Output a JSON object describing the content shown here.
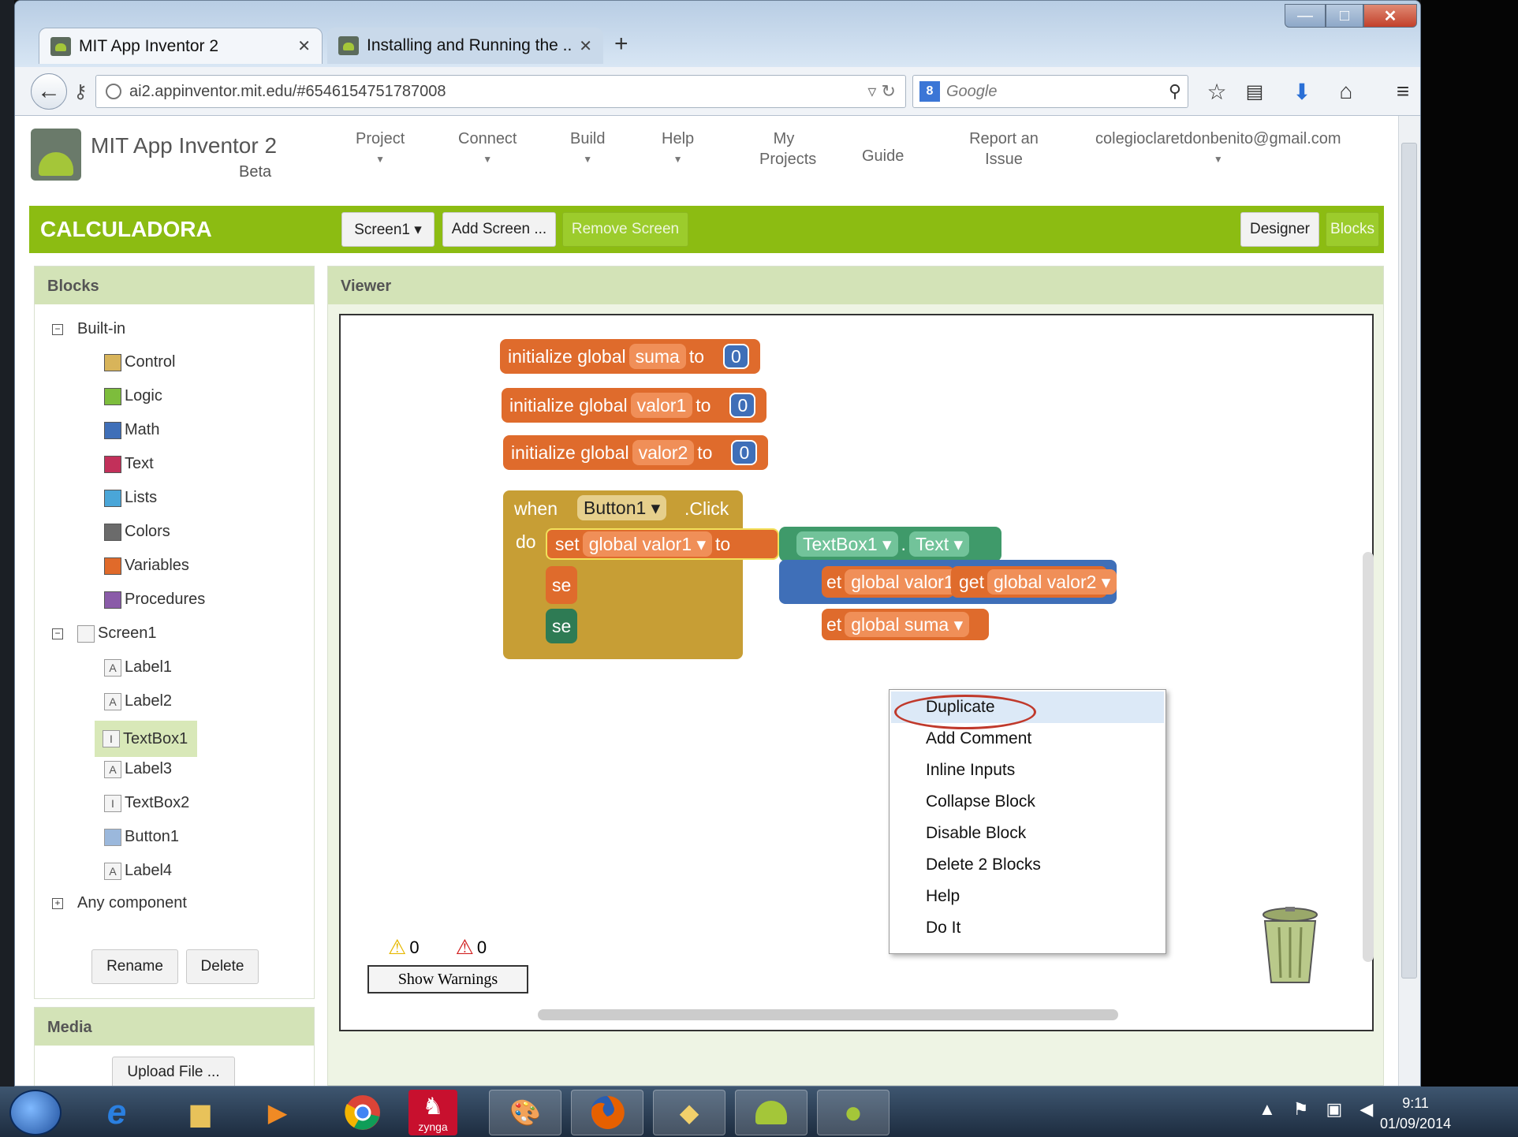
{
  "browser": {
    "tabs": [
      {
        "title": "MIT App Inventor 2",
        "close": "✕"
      },
      {
        "title": "Installing and Running the ...",
        "close": "✕"
      }
    ],
    "new_tab": "+",
    "url": "ai2.appinventor.mit.edu/#6546154751787008",
    "search_placeholder": "Google",
    "search_engine_badge": "8",
    "window_controls": {
      "minimize": "—",
      "maximize": "□",
      "close": "✕"
    }
  },
  "app": {
    "brand": "MIT App Inventor 2",
    "beta": "Beta",
    "menus": [
      "Project",
      "Connect",
      "Build",
      "Help",
      "My Projects",
      "Guide",
      "Report an Issue",
      "colegioclaretdonbenito@gmail.com"
    ],
    "project_name": "CALCULADORA",
    "screen_select": "Screen1 ▾",
    "add_screen": "Add Screen ...",
    "remove_screen": "Remove Screen",
    "designer": "Designer",
    "blocks_btn": "Blocks"
  },
  "blocks_panel": {
    "title": "Blocks",
    "builtin": "Built-in",
    "builtin_items": [
      {
        "label": "Control",
        "color": "#d8b45a"
      },
      {
        "label": "Logic",
        "color": "#7dbd3c"
      },
      {
        "label": "Math",
        "color": "#3f6fb8"
      },
      {
        "label": "Text",
        "color": "#c2305a"
      },
      {
        "label": "Lists",
        "color": "#4aa6d8"
      },
      {
        "label": "Colors",
        "color": "#6b6b6b"
      },
      {
        "label": "Variables",
        "color": "#e06a2a"
      },
      {
        "label": "Procedures",
        "color": "#8a5ba8"
      }
    ],
    "screen": "Screen1",
    "components": [
      "Label1",
      "Label2",
      "TextBox1",
      "Label3",
      "TextBox2",
      "Button1",
      "Label4"
    ],
    "any_component": "Any component",
    "rename": "Rename",
    "delete": "Delete"
  },
  "media_panel": {
    "title": "Media",
    "upload": "Upload File ..."
  },
  "viewer": {
    "title": "Viewer",
    "globals": [
      {
        "prefix": "initialize global",
        "name": "suma",
        "to": "to",
        "value": "0"
      },
      {
        "prefix": "initialize global",
        "name": "valor1",
        "to": "to",
        "value": "0"
      },
      {
        "prefix": "initialize global",
        "name": "valor2",
        "to": "to",
        "value": "0"
      }
    ],
    "event": {
      "when": "when",
      "component": "Button1 ▾",
      "event": ".Click",
      "do": "do",
      "set1": "set",
      "var1": "global valor1 ▾",
      "to": "to",
      "textbox": "TextBox1 ▾",
      "dot": ".",
      "prop": "Text ▾",
      "get_a": "get",
      "var_a": "global valor1 ▾",
      "plus": "+",
      "get_b": "get",
      "var_b": "global valor2 ▾",
      "get_c": "get",
      "var_c": "global suma ▾",
      "frag2": "se",
      "frag3": "se",
      "frag_get_a": "et",
      "frag_get_c": "et"
    },
    "warnings_count": "0",
    "errors_count": "0",
    "show_warnings": "Show Warnings"
  },
  "context_menu": [
    "Duplicate",
    "Add Comment",
    "Inline Inputs",
    "Collapse Block",
    "Disable Block",
    "Delete 2 Blocks",
    "Help",
    "Do It"
  ],
  "taskbar": {
    "time": "9:11",
    "date": "01/09/2014",
    "zynga": "zynga"
  }
}
